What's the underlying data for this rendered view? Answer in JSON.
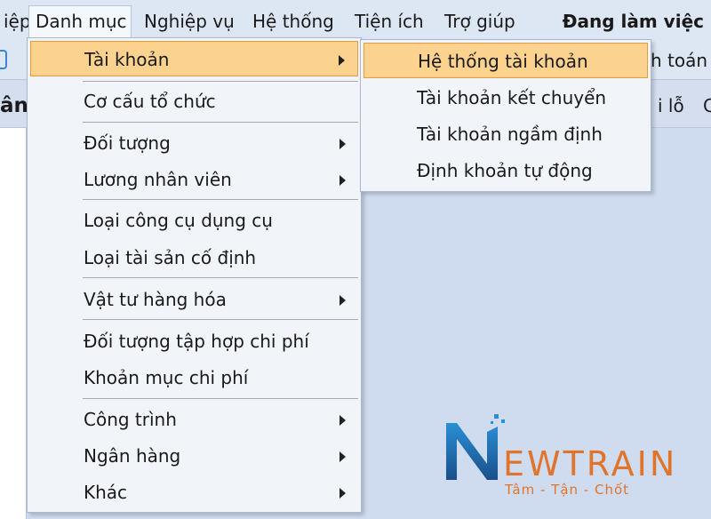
{
  "menubar": {
    "items": [
      "iệp",
      "Danh mục",
      "Nghiệp vụ",
      "Hệ thống",
      "Tiện ích",
      "Trợ giúp"
    ],
    "status": "Đang làm việc"
  },
  "toolbar": {
    "partial_text": "h toán"
  },
  "tabstrip": {
    "left_partial": "ân",
    "lo": "i lỗ",
    "c": "C"
  },
  "dropdown": {
    "items": [
      {
        "label": "Tài khoản",
        "submenu": true
      },
      {
        "label": "Cơ cấu tổ chức",
        "submenu": false
      },
      {
        "label": "Đối tượng",
        "submenu": true
      },
      {
        "label": "Lương nhân viên",
        "submenu": true
      },
      {
        "label": "Loại công cụ dụng cụ",
        "submenu": false
      },
      {
        "label": "Loại tài sản cố định",
        "submenu": false
      },
      {
        "label": "Vật tư hàng hóa",
        "submenu": true
      },
      {
        "label": "Đối tượng tập hợp chi phí",
        "submenu": false
      },
      {
        "label": "Khoản mục chi phí",
        "submenu": false
      },
      {
        "label": "Công trình",
        "submenu": true
      },
      {
        "label": "Ngân hàng",
        "submenu": true
      },
      {
        "label": "Khác",
        "submenu": true
      }
    ]
  },
  "submenu": {
    "items": [
      "Hệ thống tài khoản",
      "Tài khoản kết chuyển",
      "Tài khoản ngầm định",
      "Định khoản tự động"
    ]
  },
  "logo": {
    "brand": "NEWTRAIN",
    "tagline": "Tâm - Tận - Chốt"
  },
  "colors": {
    "highlight": "#fbd38f",
    "highlight_border": "#e89a3c",
    "brand_orange": "#e0742b",
    "brand_blue": "#1f6fb8"
  }
}
